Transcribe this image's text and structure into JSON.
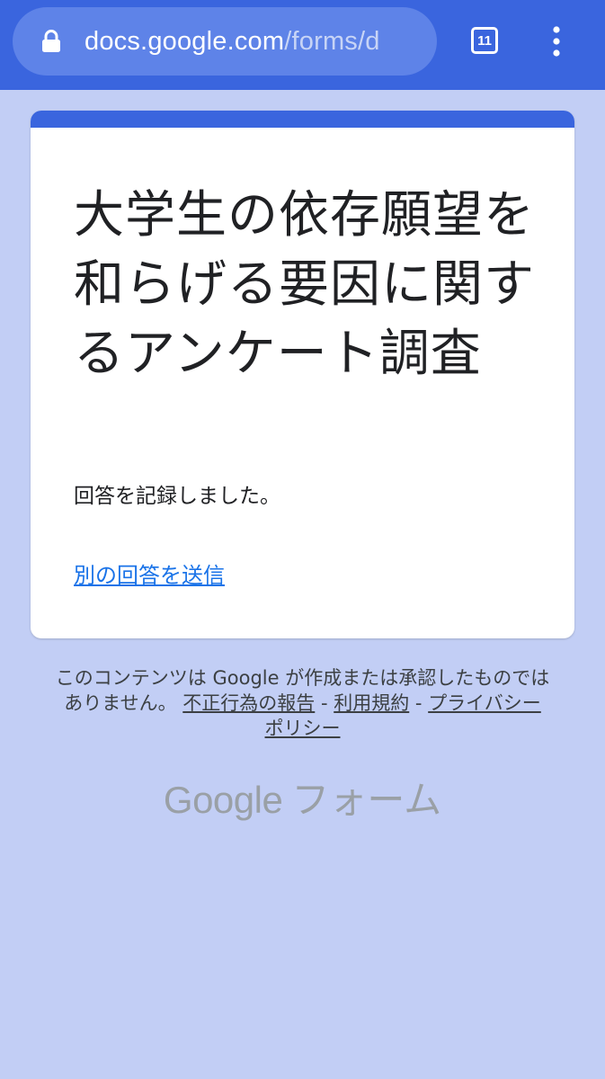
{
  "browser": {
    "url_host": "docs.google.com",
    "url_path": "/forms/d",
    "tab_count": "11"
  },
  "form": {
    "title": "大学生の依存願望を和らげる要因に関するアンケート調査",
    "confirmation_message": "回答を記録しました。",
    "resubmit_link": "別の回答を送信"
  },
  "footer": {
    "disclaimer": "このコンテンツは Google が作成または承認したものではありません。",
    "report_abuse": "不正行為の報告",
    "separator": "-",
    "terms": "利用規約",
    "privacy": "プライバシー ポリシー"
  },
  "brand": {
    "google": "Google",
    "product": "フォーム"
  },
  "colors": {
    "browser_bar": "#3a65de",
    "page_background": "#c2cef5",
    "link": "#1a73e8"
  }
}
